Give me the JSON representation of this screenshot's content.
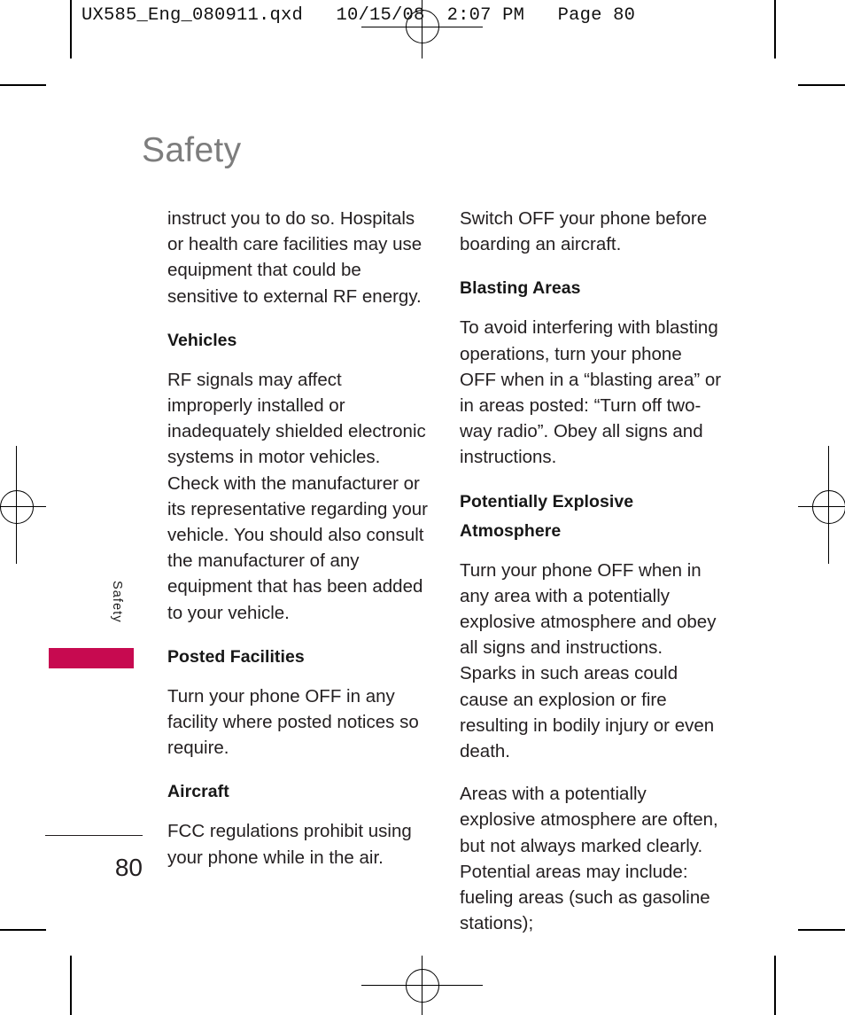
{
  "print_header": "UX585_Eng_080911.qxd   10/15/08  2:07 PM   Page 80",
  "sidebar": {
    "tab_label": "Safety",
    "tab_color": "#c70a50"
  },
  "page_title": "Safety",
  "folio": "80",
  "columns": {
    "left": [
      {
        "type": "paragraph",
        "text": "instruct you to do so. Hospitals or health care facilities may use equipment that could be sensitive to external RF energy."
      },
      {
        "type": "heading",
        "text": "Vehicles"
      },
      {
        "type": "paragraph",
        "text": "RF signals may affect improperly installed or inadequately shielded electronic systems in motor vehicles. Check with the manufacturer or its representative regarding your vehicle. You should also consult the manufacturer of any equipment that has been added to your vehicle."
      },
      {
        "type": "heading",
        "text": "Posted Facilities"
      },
      {
        "type": "paragraph",
        "text": "Turn your phone OFF in any facility where posted notices so require."
      },
      {
        "type": "heading",
        "text": "Aircraft"
      },
      {
        "type": "paragraph",
        "text": "FCC regulations prohibit using your phone while in the air."
      }
    ],
    "right": [
      {
        "type": "paragraph",
        "text": "Switch OFF your phone before boarding an aircraft."
      },
      {
        "type": "heading",
        "text": "Blasting Areas"
      },
      {
        "type": "paragraph",
        "text": "To avoid interfering with blasting operations, turn your phone OFF when in a “blasting area” or in areas posted: “Turn off two-way radio”. Obey all signs and instructions."
      },
      {
        "type": "heading",
        "text": "Potentially Explosive Atmosphere"
      },
      {
        "type": "paragraph",
        "text": "Turn your phone OFF when in any area with a potentially explosive atmosphere and obey all signs and instructions. Sparks in such areas could cause an explosion or fire resulting in bodily injury or even death."
      },
      {
        "type": "paragraph",
        "text": "Areas with a potentially explosive atmosphere are often, but not always marked clearly. Potential areas may include: fueling areas (such as gasoline stations);"
      }
    ]
  }
}
